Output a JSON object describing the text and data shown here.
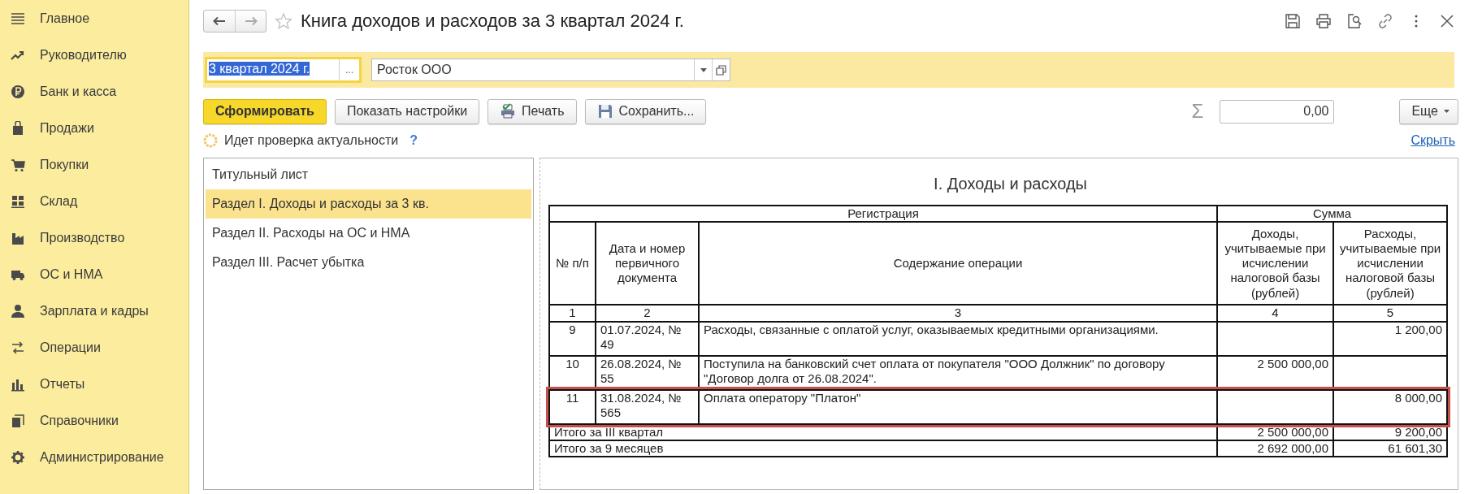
{
  "sidebar": {
    "items": [
      {
        "label": "Главное"
      },
      {
        "label": "Руководителю"
      },
      {
        "label": "Банк и касса"
      },
      {
        "label": "Продажи"
      },
      {
        "label": "Покупки"
      },
      {
        "label": "Склад"
      },
      {
        "label": "Производство"
      },
      {
        "label": "ОС и НМА"
      },
      {
        "label": "Зарплата и кадры"
      },
      {
        "label": "Операции"
      },
      {
        "label": "Отчеты"
      },
      {
        "label": "Справочники"
      },
      {
        "label": "Администрирование"
      }
    ]
  },
  "window": {
    "title": "Книга доходов и расходов за 3 квартал 2024 г."
  },
  "filters": {
    "period": "3 квартал 2024 г.",
    "period_text_selected": true,
    "period_button": "...",
    "organization": "Росток ООО"
  },
  "toolbar": {
    "buttons": [
      {
        "label": "Сформировать",
        "kind": "primary"
      },
      {
        "label": "Показать настройки",
        "kind": "plain"
      },
      {
        "label": "Печать",
        "kind": "print"
      },
      {
        "label": "Сохранить...",
        "kind": "save"
      }
    ],
    "sum_symbol": "Σ",
    "sum_value": "0,00",
    "more": "Еще"
  },
  "status": {
    "text": "Идет проверка актуальности",
    "help": "?",
    "hide_link": "Скрыть"
  },
  "sections": [
    {
      "label": "Титульный лист",
      "selected": false
    },
    {
      "label": "Раздел I. Доходы и расходы за 3 кв.",
      "selected": true
    },
    {
      "label": "Раздел II. Расходы на ОС и НМА",
      "selected": false
    },
    {
      "label": "Раздел III. Расчет убытка",
      "selected": false
    }
  ],
  "report": {
    "title": "I. Доходы и расходы",
    "group_headers": [
      "Регистрация",
      "Сумма"
    ],
    "columns": [
      "№ п/п",
      "Дата и номер первичного документа",
      "Содержание операции",
      "Доходы, учитываемые при исчислении налоговой базы (рублей)",
      "Расходы, учитываемые при исчислении налоговой базы (рублей)"
    ],
    "column_numbers": [
      "1",
      "2",
      "3",
      "4",
      "5"
    ],
    "rows": [
      {
        "number": "9",
        "document": "01.07.2024, № 49",
        "content": "Расходы, связанные с оплатой услуг, оказываемых кредитными организациями.",
        "income": "",
        "expense": "1 200,00",
        "highlighted": false
      },
      {
        "number": "10",
        "document": "26.08.2024, № 55",
        "content": "Поступила на банковский счет оплата от покупателя \"ООО Должник\" по договору \"Договор долга от 26.08.2024\".",
        "income": "2 500 000,00",
        "expense": "",
        "highlighted": false
      },
      {
        "number": "11",
        "document": "31.08.2024, № 565",
        "content": "Оплата оператору \"Платон\"",
        "income": "",
        "expense": "8 000,00",
        "highlighted": true
      }
    ],
    "totals": [
      {
        "label": "Итого за III квартал",
        "income": "2 500 000,00",
        "expense": "9 200,00"
      },
      {
        "label": "Итого за 9 месяцев",
        "income": "2 692 000,00",
        "expense": "61 601,30"
      }
    ]
  }
}
